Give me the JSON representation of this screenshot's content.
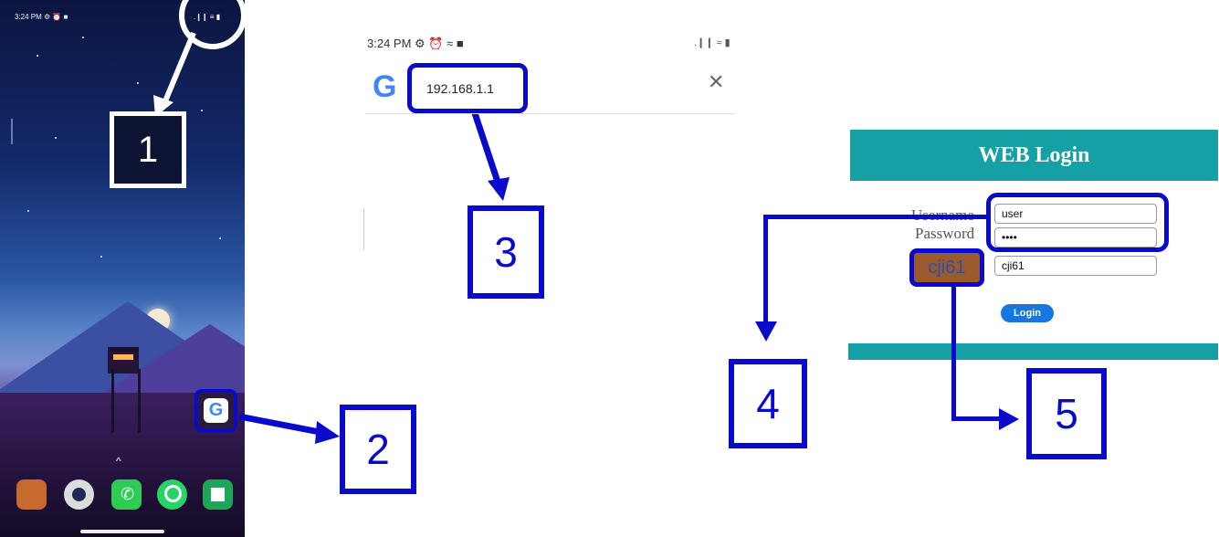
{
  "phone": {
    "status_time": "3:24 PM",
    "status_icons": "⚙ ⏰ ■",
    "signal": ".❙❙ ≡ ▮",
    "swipe_up": "^",
    "google_app_glyph": "G",
    "dock_apps": [
      {
        "icon": "camera-app-icon",
        "color": "#d06a2a"
      },
      {
        "icon": "camera-lens-icon",
        "color": "#e8e8e8"
      },
      {
        "icon": "phone-app-icon",
        "color": "#2ecc55"
      },
      {
        "icon": "whatsapp-icon",
        "color": "#25d366"
      },
      {
        "icon": "gallery-app-icon",
        "color": "#1fa55a"
      }
    ]
  },
  "browser": {
    "status_time": "3:24 PM",
    "status_icons": "⚙ ⏰ ≈ ■",
    "signal": ".❙❙ ≈ ▮",
    "google_glyph": "G",
    "url": "192.168.1.1",
    "close": "✕"
  },
  "web_login": {
    "title": "WEB Login",
    "username_label": "Username",
    "password_label": "Password",
    "username_value": "user",
    "password_value": "••••",
    "captcha_text": "cji61",
    "captcha_value": "cji61",
    "login_button": "Login"
  },
  "steps": [
    "1",
    "2",
    "3",
    "4",
    "5"
  ],
  "colors": {
    "annotation_blue": "#0a0acc",
    "teal": "#14a0a5",
    "login_button": "#1677e0"
  }
}
